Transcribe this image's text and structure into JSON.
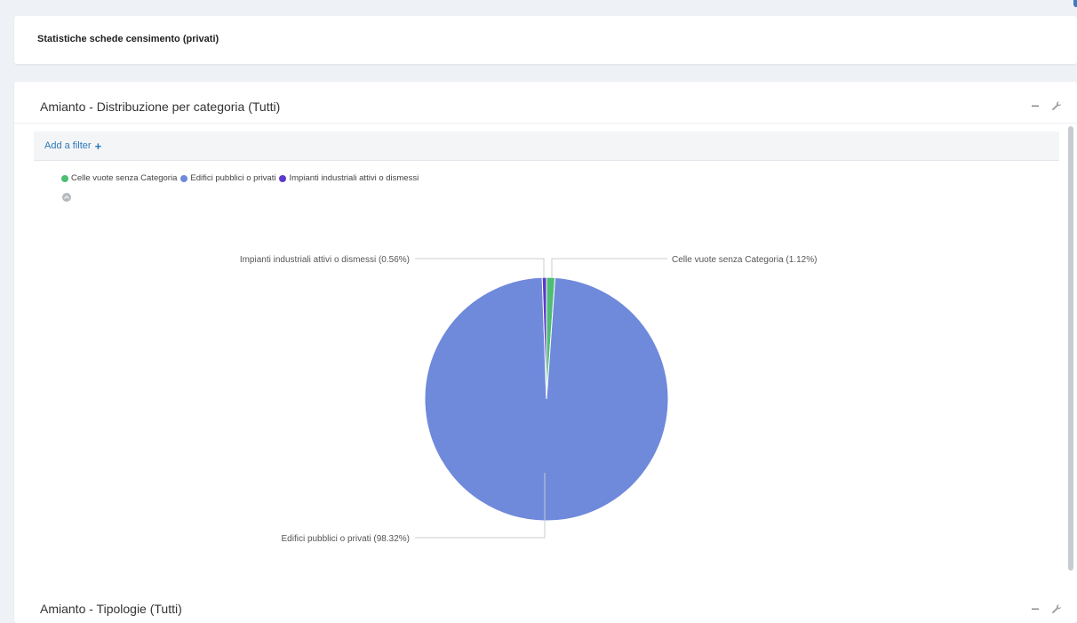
{
  "top_card": {
    "title": "Statistiche schede censimento (privati)"
  },
  "widget": {
    "title": "Amianto - Distribuzione per categoria (Tutti)",
    "add_filter_label": "Add a filter",
    "legend": [
      {
        "label": "Celle vuote senza Categoria",
        "color": "#4dbd74"
      },
      {
        "label": "Edifici pubblici o privati",
        "color": "#6f89db"
      },
      {
        "label": "Impianti industriali attivi o dismessi",
        "color": "#5b3ac9"
      }
    ]
  },
  "widget2": {
    "title": "Amianto - Tipologie (Tutti)"
  },
  "chart_data": {
    "type": "pie",
    "slices": [
      {
        "label": "Celle vuote senza Categoria",
        "value": 1.12,
        "display": "Celle vuote senza Categoria (1.12%)",
        "color": "#4dbd74"
      },
      {
        "label": "Edifici pubblici o privati",
        "value": 98.32,
        "display": "Edifici pubblici o privati (98.32%)",
        "color": "#6f89db"
      },
      {
        "label": "Impianti industriali attivi o dismessi",
        "value": 0.56,
        "display": "Impianti industriali attivi o dismessi (0.56%)",
        "color": "#5b3ac9"
      }
    ],
    "legend": "top-left"
  }
}
